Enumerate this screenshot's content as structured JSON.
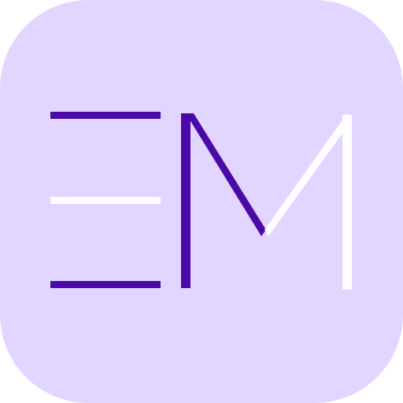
{
  "icon": {
    "name": "EM app icon",
    "monogram": "EM",
    "colors": {
      "background": "#E2D5FF",
      "accent": "#4A0AA8",
      "highlight": "#FFFFFF"
    }
  }
}
